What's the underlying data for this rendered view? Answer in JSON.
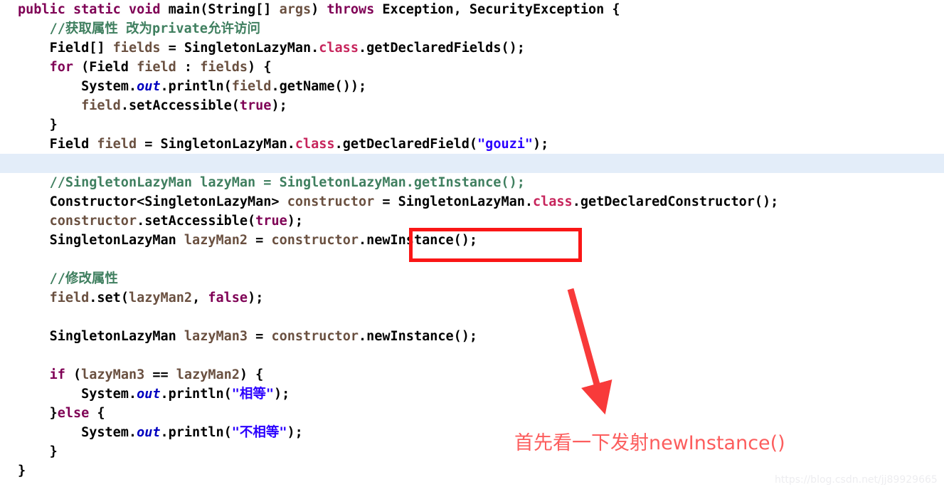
{
  "editor": {
    "language": "java",
    "background": "#ffffff",
    "current_line_highlight_color": "#e3edf9",
    "colors": {
      "keyword": "#7f0055",
      "comment": "#3f7f5f",
      "string": "#2a00ff",
      "variable": "#6a5040",
      "class_keyword": "#c7255c",
      "static_field": "#0000c0",
      "plain": "#000000"
    },
    "lines": [
      {
        "id": 1,
        "indent": 0,
        "highlight": false,
        "tokens": [
          {
            "t": "public",
            "c": "kw"
          },
          {
            "t": " ",
            "c": "pl"
          },
          {
            "t": "static",
            "c": "kw"
          },
          {
            "t": " ",
            "c": "pl"
          },
          {
            "t": "void",
            "c": "kw"
          },
          {
            "t": " ",
            "c": "pl"
          },
          {
            "t": "main(String[] ",
            "c": "pl"
          },
          {
            "t": "args",
            "c": "var"
          },
          {
            "t": ") ",
            "c": "pl"
          },
          {
            "t": "throws",
            "c": "kw"
          },
          {
            "t": " Exception, SecurityException {",
            "c": "pl"
          }
        ]
      },
      {
        "id": 2,
        "indent": 1,
        "highlight": false,
        "tokens": [
          {
            "t": "//获取属性 改为private允许访问",
            "c": "cmt"
          }
        ]
      },
      {
        "id": 3,
        "indent": 1,
        "highlight": false,
        "tokens": [
          {
            "t": "Field[] ",
            "c": "pl"
          },
          {
            "t": "fields",
            "c": "var"
          },
          {
            "t": " = SingletonLazyMan.",
            "c": "pl"
          },
          {
            "t": "class",
            "c": "cls"
          },
          {
            "t": ".getDeclaredFields();",
            "c": "pl"
          }
        ]
      },
      {
        "id": 4,
        "indent": 1,
        "highlight": false,
        "tokens": [
          {
            "t": "for",
            "c": "kw"
          },
          {
            "t": " (Field ",
            "c": "pl"
          },
          {
            "t": "field",
            "c": "var"
          },
          {
            "t": " : ",
            "c": "pl"
          },
          {
            "t": "fields",
            "c": "var"
          },
          {
            "t": ") {",
            "c": "pl"
          }
        ]
      },
      {
        "id": 5,
        "indent": 2,
        "highlight": false,
        "tokens": [
          {
            "t": "System.",
            "c": "pl"
          },
          {
            "t": "out",
            "c": "stf"
          },
          {
            "t": ".println(",
            "c": "pl"
          },
          {
            "t": "field",
            "c": "var"
          },
          {
            "t": ".getName());",
            "c": "pl"
          }
        ]
      },
      {
        "id": 6,
        "indent": 2,
        "highlight": false,
        "tokens": [
          {
            "t": "field",
            "c": "var"
          },
          {
            "t": ".setAccessible(",
            "c": "pl"
          },
          {
            "t": "true",
            "c": "kw"
          },
          {
            "t": ");",
            "c": "pl"
          }
        ]
      },
      {
        "id": 7,
        "indent": 1,
        "highlight": false,
        "tokens": [
          {
            "t": "}",
            "c": "pl"
          }
        ]
      },
      {
        "id": 8,
        "indent": 1,
        "highlight": false,
        "tokens": [
          {
            "t": "Field ",
            "c": "pl"
          },
          {
            "t": "field",
            "c": "var"
          },
          {
            "t": " = SingletonLazyMan.",
            "c": "pl"
          },
          {
            "t": "class",
            "c": "cls"
          },
          {
            "t": ".getDeclaredField(",
            "c": "pl"
          },
          {
            "t": "\"gouzi\"",
            "c": "str"
          },
          {
            "t": ");",
            "c": "pl"
          }
        ]
      },
      {
        "id": 9,
        "indent": 0,
        "highlight": true,
        "tokens": []
      },
      {
        "id": 10,
        "indent": 1,
        "highlight": false,
        "tokens": [
          {
            "t": "//SingletonLazyMan lazyMan = SingletonLazyMan.getInstance();",
            "c": "cmt"
          }
        ]
      },
      {
        "id": 11,
        "indent": 1,
        "highlight": false,
        "tokens": [
          {
            "t": "Constructor<SingletonLazyMan> ",
            "c": "pl"
          },
          {
            "t": "constructor",
            "c": "var"
          },
          {
            "t": " = SingletonLazyMan.",
            "c": "pl"
          },
          {
            "t": "class",
            "c": "cls"
          },
          {
            "t": ".getDeclaredConstructor();",
            "c": "pl"
          }
        ]
      },
      {
        "id": 12,
        "indent": 1,
        "highlight": false,
        "tokens": [
          {
            "t": "constructor",
            "c": "var"
          },
          {
            "t": ".setAccessible(",
            "c": "pl"
          },
          {
            "t": "true",
            "c": "kw"
          },
          {
            "t": ");",
            "c": "pl"
          }
        ]
      },
      {
        "id": 13,
        "indent": 1,
        "highlight": false,
        "tokens": [
          {
            "t": "SingletonLazyMan ",
            "c": "pl"
          },
          {
            "t": "lazyMan2",
            "c": "var"
          },
          {
            "t": " = ",
            "c": "pl"
          },
          {
            "t": "constructor",
            "c": "var"
          },
          {
            "t": ".newInstance();",
            "c": "pl"
          }
        ]
      },
      {
        "id": 14,
        "indent": 0,
        "highlight": false,
        "tokens": []
      },
      {
        "id": 15,
        "indent": 1,
        "highlight": false,
        "tokens": [
          {
            "t": "//修改属性",
            "c": "cmt"
          }
        ]
      },
      {
        "id": 16,
        "indent": 1,
        "highlight": false,
        "tokens": [
          {
            "t": "field",
            "c": "var"
          },
          {
            "t": ".set(",
            "c": "pl"
          },
          {
            "t": "lazyMan2",
            "c": "var"
          },
          {
            "t": ", ",
            "c": "pl"
          },
          {
            "t": "false",
            "c": "kw"
          },
          {
            "t": ");",
            "c": "pl"
          }
        ]
      },
      {
        "id": 17,
        "indent": 0,
        "highlight": false,
        "tokens": []
      },
      {
        "id": 18,
        "indent": 1,
        "highlight": false,
        "tokens": [
          {
            "t": "SingletonLazyMan ",
            "c": "pl"
          },
          {
            "t": "lazyMan3",
            "c": "var"
          },
          {
            "t": " = ",
            "c": "pl"
          },
          {
            "t": "constructor",
            "c": "var"
          },
          {
            "t": ".newInstance();",
            "c": "pl"
          }
        ]
      },
      {
        "id": 19,
        "indent": 0,
        "highlight": false,
        "tokens": []
      },
      {
        "id": 20,
        "indent": 1,
        "highlight": false,
        "tokens": [
          {
            "t": "if",
            "c": "kw"
          },
          {
            "t": " (",
            "c": "pl"
          },
          {
            "t": "lazyMan3",
            "c": "var"
          },
          {
            "t": " == ",
            "c": "pl"
          },
          {
            "t": "lazyMan2",
            "c": "var"
          },
          {
            "t": ") {",
            "c": "pl"
          }
        ]
      },
      {
        "id": 21,
        "indent": 2,
        "highlight": false,
        "tokens": [
          {
            "t": "System.",
            "c": "pl"
          },
          {
            "t": "out",
            "c": "stf"
          },
          {
            "t": ".println(",
            "c": "pl"
          },
          {
            "t": "\"相等\"",
            "c": "str"
          },
          {
            "t": ");",
            "c": "pl"
          }
        ]
      },
      {
        "id": 22,
        "indent": 1,
        "highlight": false,
        "tokens": [
          {
            "t": "}",
            "c": "pl"
          },
          {
            "t": "else",
            "c": "kw"
          },
          {
            "t": " {",
            "c": "pl"
          }
        ]
      },
      {
        "id": 23,
        "indent": 2,
        "highlight": false,
        "tokens": [
          {
            "t": "System.",
            "c": "pl"
          },
          {
            "t": "out",
            "c": "stf"
          },
          {
            "t": ".println(",
            "c": "pl"
          },
          {
            "t": "\"不相等\"",
            "c": "str"
          },
          {
            "t": ");",
            "c": "pl"
          }
        ]
      },
      {
        "id": 24,
        "indent": 1,
        "highlight": false,
        "tokens": [
          {
            "t": "}",
            "c": "pl"
          }
        ]
      },
      {
        "id": 25,
        "indent": 0,
        "highlight": false,
        "tokens": [
          {
            "t": "}",
            "c": "pl"
          }
        ]
      }
    ]
  },
  "annotations": {
    "highlight_box": {
      "label": ".newInstance();",
      "color": "#fa1616",
      "border_width_px": 5
    },
    "arrow": {
      "color": "#f83a3a"
    },
    "note": {
      "text": "首先看一下发射newInstance()",
      "color": "#fc5d5d"
    }
  },
  "watermark": {
    "text": "https://blog.csdn.net/jj89929665",
    "color": "#ededf0"
  }
}
